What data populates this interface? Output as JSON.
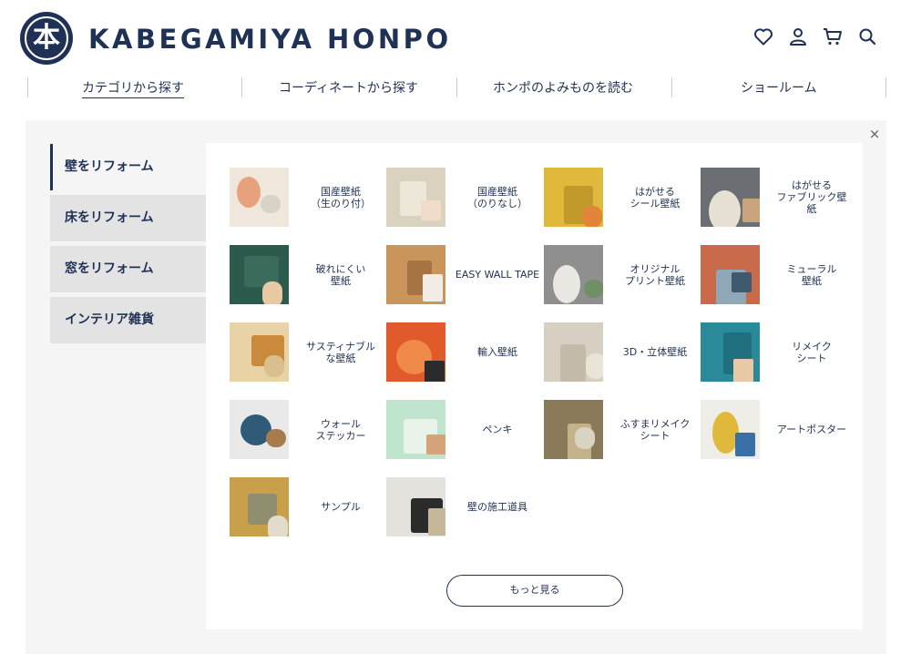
{
  "header": {
    "logo_mark": "本",
    "logo_text": "KABEGAMIYA HONPO",
    "icons": [
      "heart-icon",
      "user-icon",
      "cart-icon",
      "search-icon"
    ]
  },
  "nav": {
    "items": [
      {
        "label": "カテゴリから探す",
        "active": true
      },
      {
        "label": "コーディネートから探す"
      },
      {
        "label": "ホンポのよみものを読む"
      },
      {
        "label": "ショールーム"
      }
    ]
  },
  "menu": {
    "close": "×",
    "side_items": [
      {
        "label": "壁をリフォーム",
        "active": true
      },
      {
        "label": "床をリフォーム"
      },
      {
        "label": "窓をリフォーム"
      },
      {
        "label": "インテリア雑貨"
      }
    ],
    "categories": [
      {
        "label": "国産壁紙\n（生のり付）",
        "colors": [
          "#efe6dc",
          "#e7a27d",
          "#d9d2c8"
        ]
      },
      {
        "label": "国産壁紙\n（のりなし）",
        "colors": [
          "#d8d2bf",
          "#ece7d8",
          "#f0dcc8"
        ]
      },
      {
        "label": "はがせる\nシール壁紙",
        "colors": [
          "#e0b93c",
          "#c29a2c",
          "#e2843a"
        ]
      },
      {
        "label": "はがせる\nファブリック壁\n紙",
        "colors": [
          "#6b6f73",
          "#e7e1d5",
          "#c9a37c"
        ]
      },
      {
        "label": "破れにくい\n壁紙",
        "colors": [
          "#2c5a4c",
          "#3a6b5b",
          "#e9c9a3"
        ]
      },
      {
        "label": "EASY WALL TAPE",
        "colors": [
          "#c9955a",
          "#a57442",
          "#f1ede6"
        ]
      },
      {
        "label": "オリジナル\nプリント壁紙",
        "colors": [
          "#8f8f8f",
          "#e9e7e1",
          "#6f8f67"
        ]
      },
      {
        "label": "ミューラル\n壁紙",
        "colors": [
          "#c96a4b",
          "#8fa7b7",
          "#3f5a6e"
        ]
      },
      {
        "label": "サスティナブル\nな壁紙",
        "colors": [
          "#e9d3a6",
          "#c98a3c",
          "#d9bf8e"
        ]
      },
      {
        "label": "輸入壁紙",
        "colors": [
          "#e05a2c",
          "#f08a4a",
          "#2b2b2b"
        ]
      },
      {
        "label": "3D・立体壁紙",
        "colors": [
          "#d7cfc1",
          "#c4baa9",
          "#eae4d8"
        ]
      },
      {
        "label": "リメイク\nシート",
        "colors": [
          "#2a8a9a",
          "#1f6f7f",
          "#e9c9a3"
        ]
      },
      {
        "label": "ウォール\nステッカー",
        "colors": [
          "#e9e9ea",
          "#2f5a78",
          "#a67c4d"
        ]
      },
      {
        "label": "ペンキ",
        "colors": [
          "#bfe5cf",
          "#e9f3ea",
          "#d7a47a"
        ]
      },
      {
        "label": "ふすまリメイク\nシート",
        "colors": [
          "#8a7a5a",
          "#c4b28a",
          "#d9d3c3"
        ]
      },
      {
        "label": "アートポスター",
        "colors": [
          "#efede8",
          "#e0b93c",
          "#3b6fa8"
        ]
      },
      {
        "label": "サンプル",
        "colors": [
          "#c8a04a",
          "#8f8f6f",
          "#e3dccd"
        ]
      },
      {
        "label": "壁の施工道具",
        "colors": [
          "#e4e2dd",
          "#2b2b2b",
          "#c6b79b"
        ]
      }
    ],
    "more_label": "もっと見る"
  },
  "colors": {
    "brand_navy": "#1f3154",
    "panel_bg": "#f5f5f5",
    "side_bg": "#e3e3e3"
  }
}
